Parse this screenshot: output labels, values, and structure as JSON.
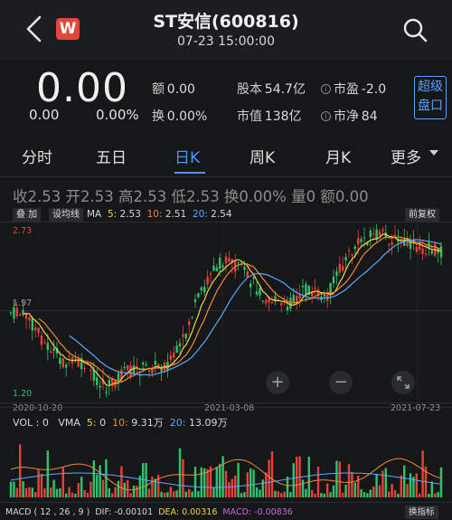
{
  "header": {
    "title": "ST安信(600816)",
    "subtitle": "07-23 15:00:00",
    "logo_text": "W"
  },
  "quote": {
    "price": "0.00",
    "change": "0.00",
    "change_pct": "0.00%",
    "amount_label": "额",
    "amount": "0.00",
    "turnover_label": "换",
    "turnover": "0.00%",
    "shares_label": "股本",
    "shares": "54.7亿",
    "mcap_label": "市值",
    "mcap": "138亿",
    "pe_label": "市盈",
    "pe": "-2.0",
    "pb_label": "市净",
    "pb": "84",
    "super_btn": [
      "超级",
      "盘口"
    ]
  },
  "tabs": [
    {
      "label": "分时",
      "active": false
    },
    {
      "label": "五日",
      "active": false
    },
    {
      "label": "日K",
      "active": true
    },
    {
      "label": "周K",
      "active": false
    },
    {
      "label": "月K",
      "active": false
    },
    {
      "label": "更多",
      "active": false
    }
  ],
  "ohlc": "收2.53 开2.53 高2.53 低2.53 换0.00% 量0 额0.00",
  "kline_bar": {
    "overlay": "叠 加",
    "indicator": "设均线",
    "ma_prefix": "MA",
    "ma5_label": "5:",
    "ma5": "2.53",
    "ma10_label": "10:",
    "ma10": "2.51",
    "ma20_label": "20:",
    "ma20": "2.54",
    "adjust": "前复权"
  },
  "price_axis": {
    "high": "2.73",
    "mid": "1.97",
    "low": "1.20"
  },
  "dates": [
    "2020-10-20",
    "2021-03-08",
    "2021-07-23"
  ],
  "zoom": {
    "in": "+",
    "out": "−"
  },
  "vol_bar": {
    "vol_label": "VOL :",
    "vol": "0",
    "vma_label": "VMA",
    "v5_label": "5:",
    "v5": "0",
    "v10_label": "10:",
    "v10": "9.31万",
    "v20_label": "20:",
    "v20": "13.09万"
  },
  "macd_bar": {
    "label": "MACD ( 12 , 26 , 9 )",
    "dif_label": "DIF:",
    "dif": "-0.00101",
    "dea_label": "DEA:",
    "dea": "0.00316",
    "macd_label": "MACD:",
    "macd": "-0.00836",
    "switch": "换指标"
  },
  "colors": {
    "up": "#e8403a",
    "down": "#2fc36b",
    "accent": "#4f93f5",
    "ma5": "#f0d44a",
    "ma10": "#f08a3a",
    "ma20": "#5ca8ff"
  }
}
